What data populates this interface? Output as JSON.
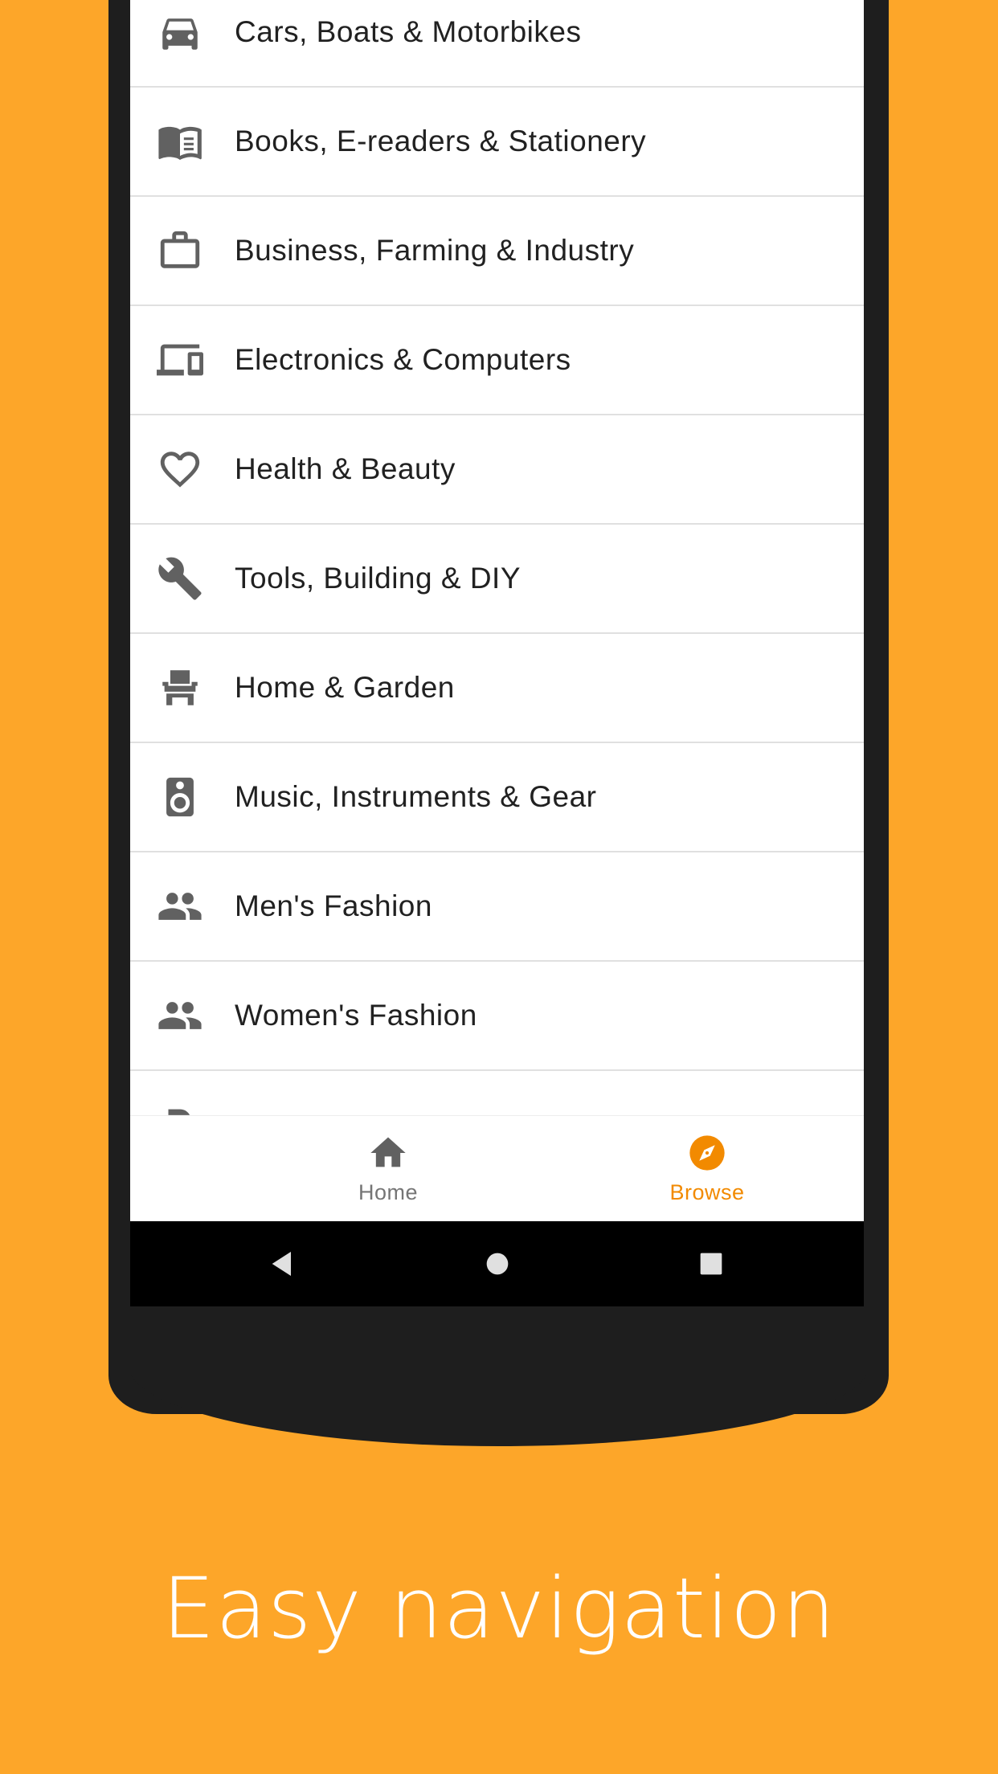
{
  "categories": [
    {
      "label": "Cars, Boats & Motorbikes",
      "icon": "car-icon"
    },
    {
      "label": "Books, E-readers & Stationery",
      "icon": "book-icon"
    },
    {
      "label": "Business, Farming & Industry",
      "icon": "briefcase-icon"
    },
    {
      "label": "Electronics & Computers",
      "icon": "devices-icon"
    },
    {
      "label": "Health & Beauty",
      "icon": "heart-icon"
    },
    {
      "label": "Tools, Building & DIY",
      "icon": "wrench-icon"
    },
    {
      "label": "Home & Garden",
      "icon": "armchair-icon"
    },
    {
      "label": "Music, Instruments & Gear",
      "icon": "speaker-icon"
    },
    {
      "label": "Men's Fashion",
      "icon": "people-icon"
    },
    {
      "label": "Women's Fashion",
      "icon": "people-icon"
    }
  ],
  "bottom_nav": {
    "home_label": "Home",
    "browse_label": "Browse",
    "active": "Browse"
  },
  "caption": "Easy navigation",
  "colors": {
    "background": "#FDA629",
    "accent": "#F28A00",
    "icon": "#616161"
  }
}
